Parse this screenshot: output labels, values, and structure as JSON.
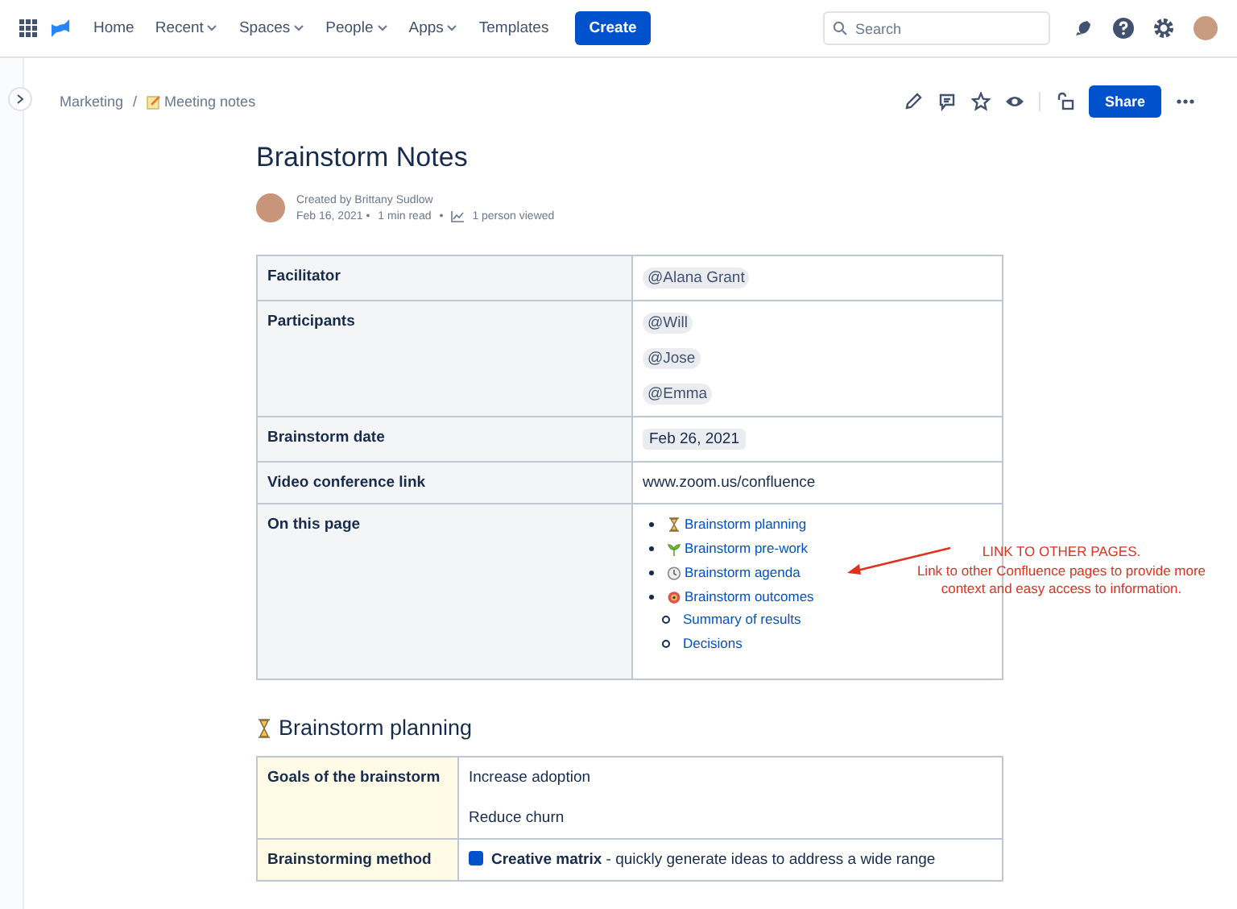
{
  "nav": {
    "items": [
      {
        "label": "Home",
        "dropdown": false
      },
      {
        "label": "Recent",
        "dropdown": true
      },
      {
        "label": "Spaces",
        "dropdown": true
      },
      {
        "label": "People",
        "dropdown": true
      },
      {
        "label": "Apps",
        "dropdown": true
      },
      {
        "label": "Templates",
        "dropdown": false
      }
    ],
    "create_button": "Create",
    "search": {
      "placeholder": "Search"
    }
  },
  "breadcrumb": [
    "Marketing",
    "Meeting notes"
  ],
  "breadcrumb_separator": "/",
  "share_button": "Share",
  "page": {
    "title": "Brainstorm Notes",
    "created_by": "Created by Brittany Sudlow",
    "date": "Feb 16, 2021 •",
    "read_time": "1 min read",
    "separator": "•",
    "views": "1 person viewed"
  },
  "table": {
    "rows": [
      {
        "kind": "mentions",
        "label": "Facilitator",
        "items": [
          "@Alana Grant"
        ]
      },
      {
        "kind": "mentions",
        "label": "Participants",
        "items": [
          "@Will",
          "@Jose",
          "@Emma"
        ]
      },
      {
        "kind": "date",
        "label": "Brainstorm date",
        "value": "Feb 26, 2021"
      },
      {
        "kind": "text",
        "label": "Video conference link",
        "value": "www.zoom.us/confluence"
      },
      {
        "kind": "toc",
        "label": "On this page",
        "items": [
          {
            "label": "Brainstorm planning"
          },
          {
            "label": "Brainstorm pre-work"
          },
          {
            "label": "Brainstorm agenda"
          },
          {
            "label": "Brainstorm outcomes",
            "children": [
              {
                "label": "Summary of results"
              },
              {
                "label": "Decisions"
              }
            ]
          }
        ]
      }
    ]
  },
  "annotation": {
    "title": "LINK TO OTHER PAGES.",
    "body": "Link to other Confluence pages to provide more context and easy access to information."
  },
  "section": {
    "heading": "Brainstorm planning",
    "rows": [
      {
        "kind": "list",
        "label": "Goals of the brainstorm",
        "items": [
          "Increase adoption",
          "Reduce churn"
        ]
      },
      {
        "kind": "check",
        "label": "Brainstorming method",
        "checked": true,
        "text": "**Creative matrix** - quickly generate ideas to address a wide range"
      }
    ]
  }
}
